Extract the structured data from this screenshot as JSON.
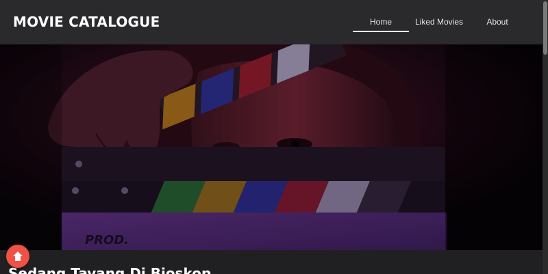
{
  "header": {
    "brand": "MOVIE CATALOGUE",
    "nav": [
      {
        "label": "Home",
        "active": true
      },
      {
        "label": "Liked Movies",
        "active": false
      },
      {
        "label": "About",
        "active": false
      }
    ]
  },
  "hero": {
    "image_icon": "clapperboard-hero-image",
    "clapper_text": "PROD."
  },
  "content": {
    "section_title": "Sedang Tayang Di Bioskop"
  },
  "back_to_top": {
    "icon": "arrow-up-icon",
    "color": "#ef5147"
  },
  "colors": {
    "header_bg": "#2a2a2c",
    "page_bg": "#202022",
    "accent": "#ef5147"
  }
}
